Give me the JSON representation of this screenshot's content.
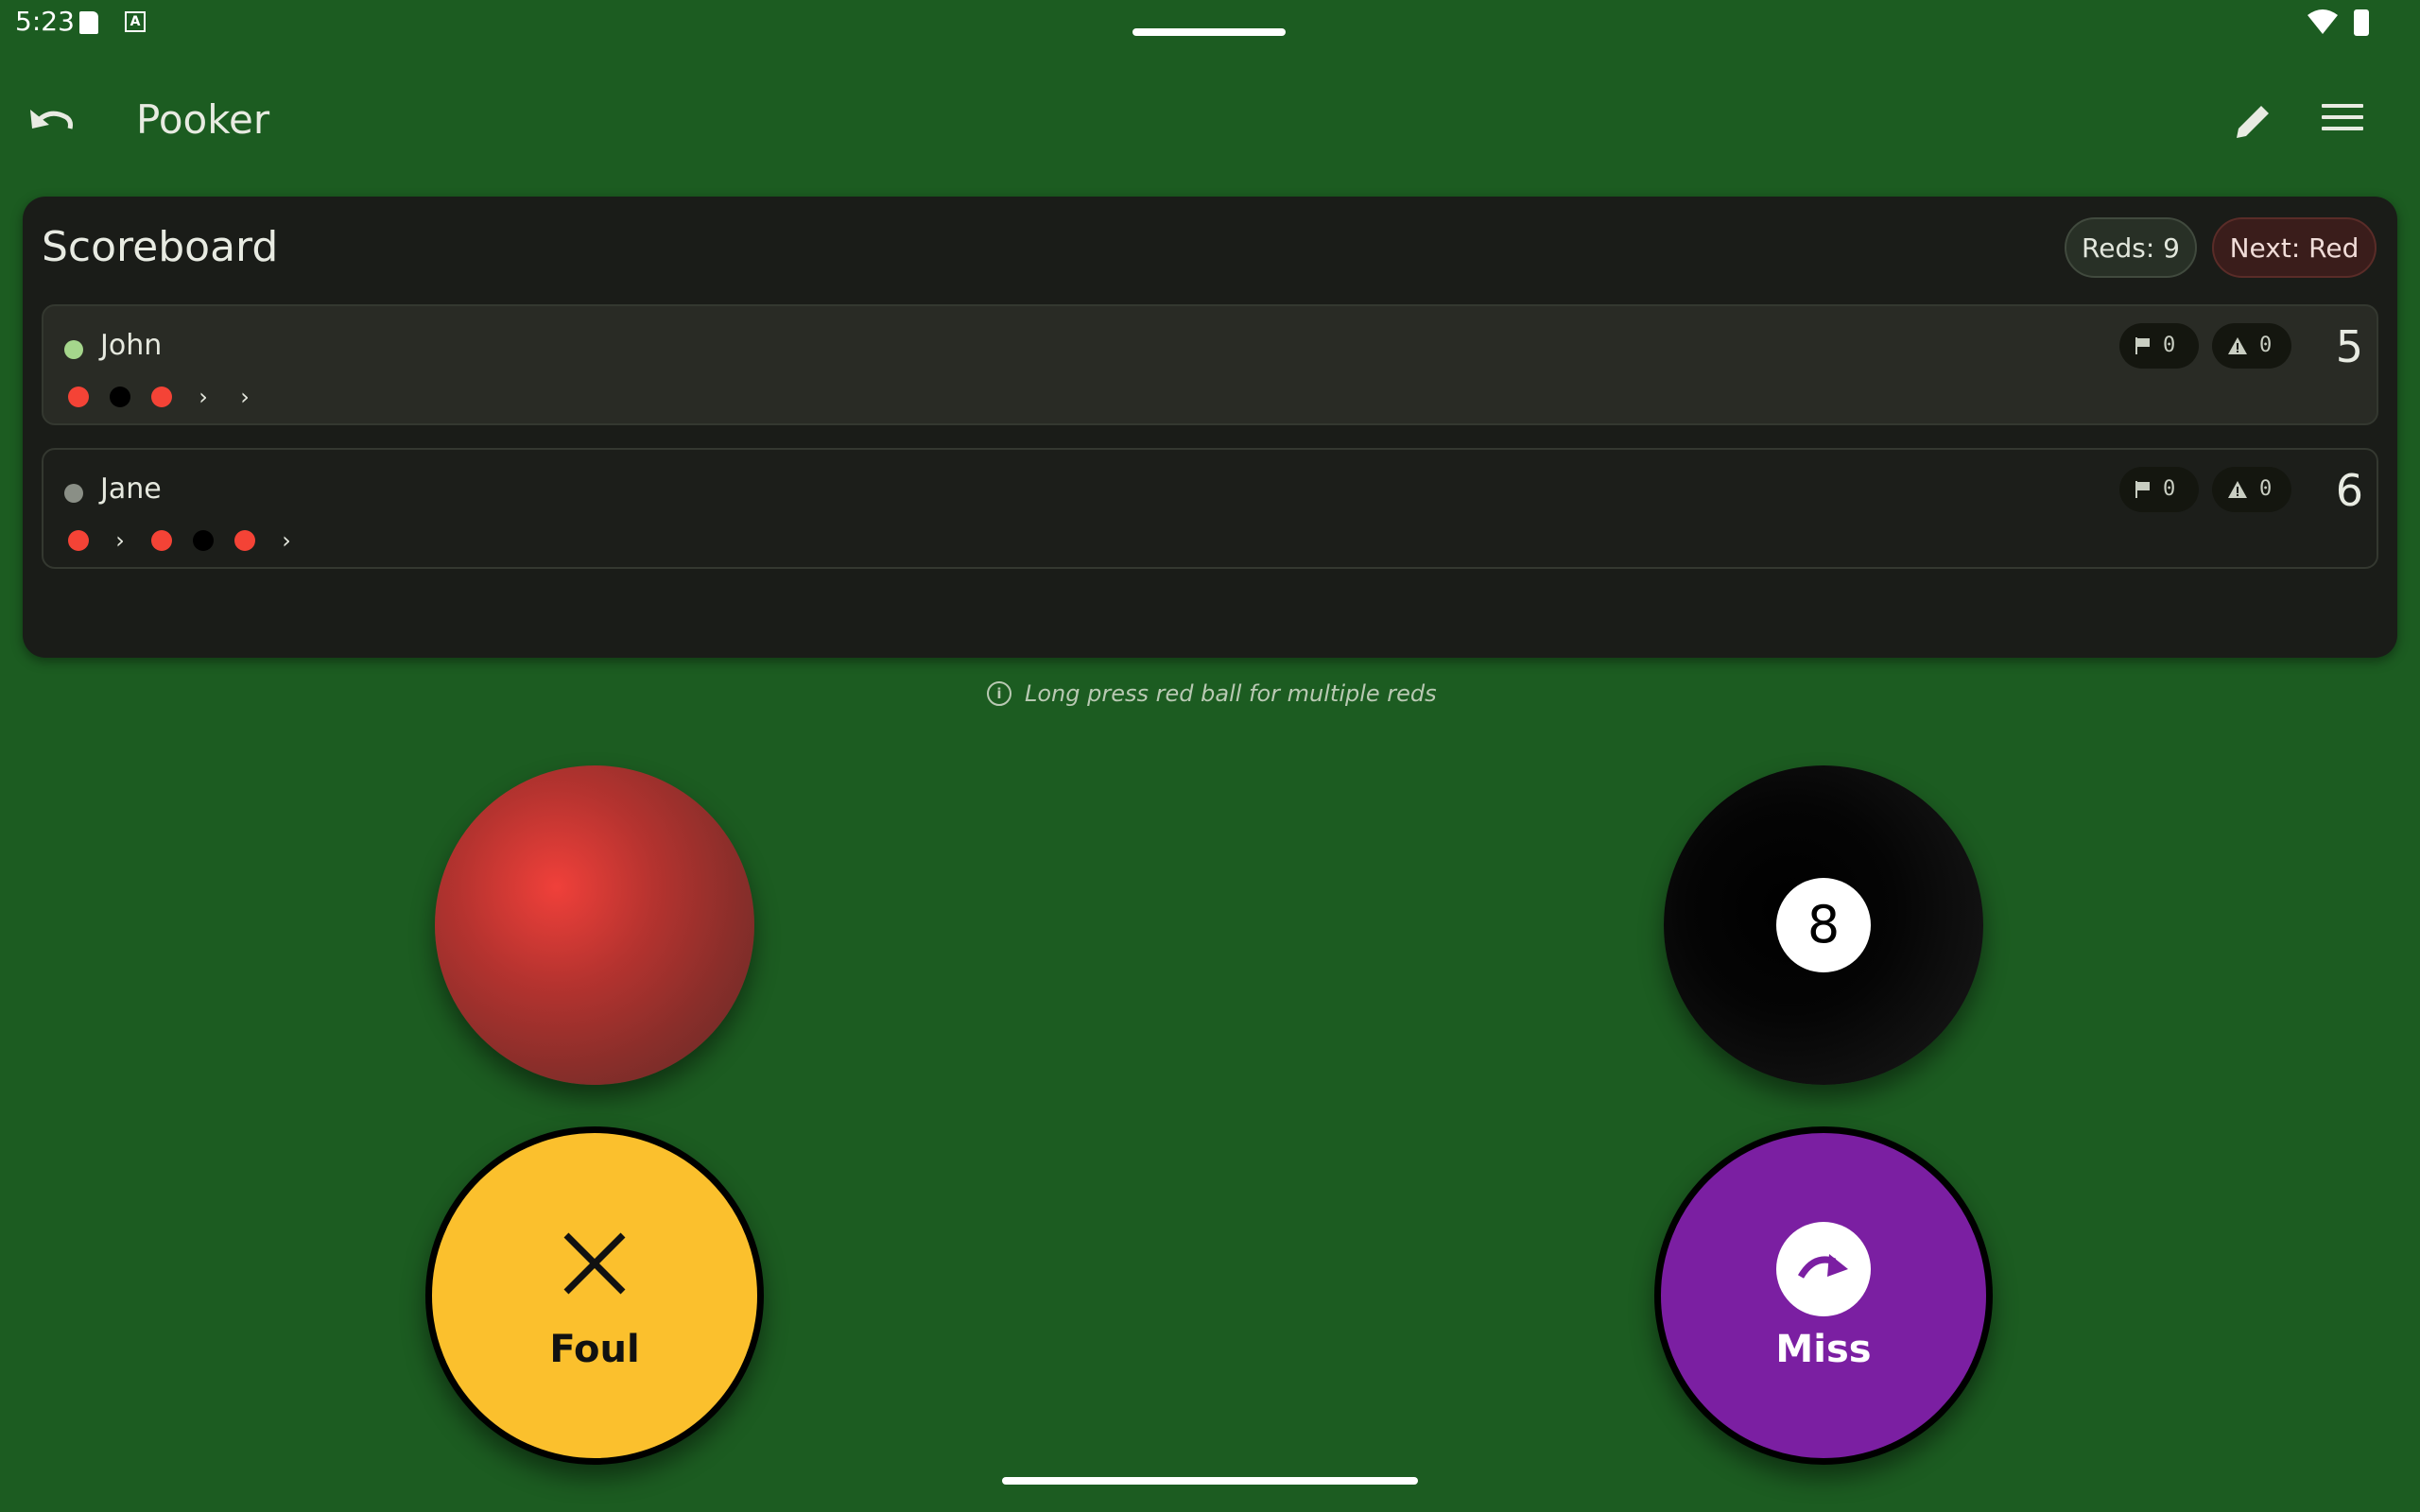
{
  "status_bar": {
    "time": "5:23"
  },
  "app_bar": {
    "title": "Pooker"
  },
  "scoreboard": {
    "title": "Scoreboard",
    "reds_chip": "Reds: 9",
    "next_chip": "Next: Red",
    "players": [
      {
        "name": "John",
        "active": true,
        "fouls": "0",
        "warnings": "0",
        "score": "5",
        "sequence": [
          "red",
          "black",
          "red",
          "arrow",
          "arrow"
        ]
      },
      {
        "name": "Jane",
        "active": false,
        "fouls": "0",
        "warnings": "0",
        "score": "6",
        "sequence": [
          "red",
          "arrow",
          "red",
          "black",
          "red",
          "arrow"
        ]
      }
    ]
  },
  "hint": {
    "text": "Long press red ball for multiple reds",
    "icon": "info-icon"
  },
  "balls": {
    "red": "red-ball",
    "black_number": "8"
  },
  "actions": {
    "foul_label": "Foul",
    "miss_label": "Miss"
  },
  "colors": {
    "felt": "#1c5c21",
    "red": "#f44336",
    "foul": "#fbc02d",
    "miss": "#7b1fa2",
    "active_dot": "#a5d68c",
    "inactive_dot": "#8a8f86"
  }
}
